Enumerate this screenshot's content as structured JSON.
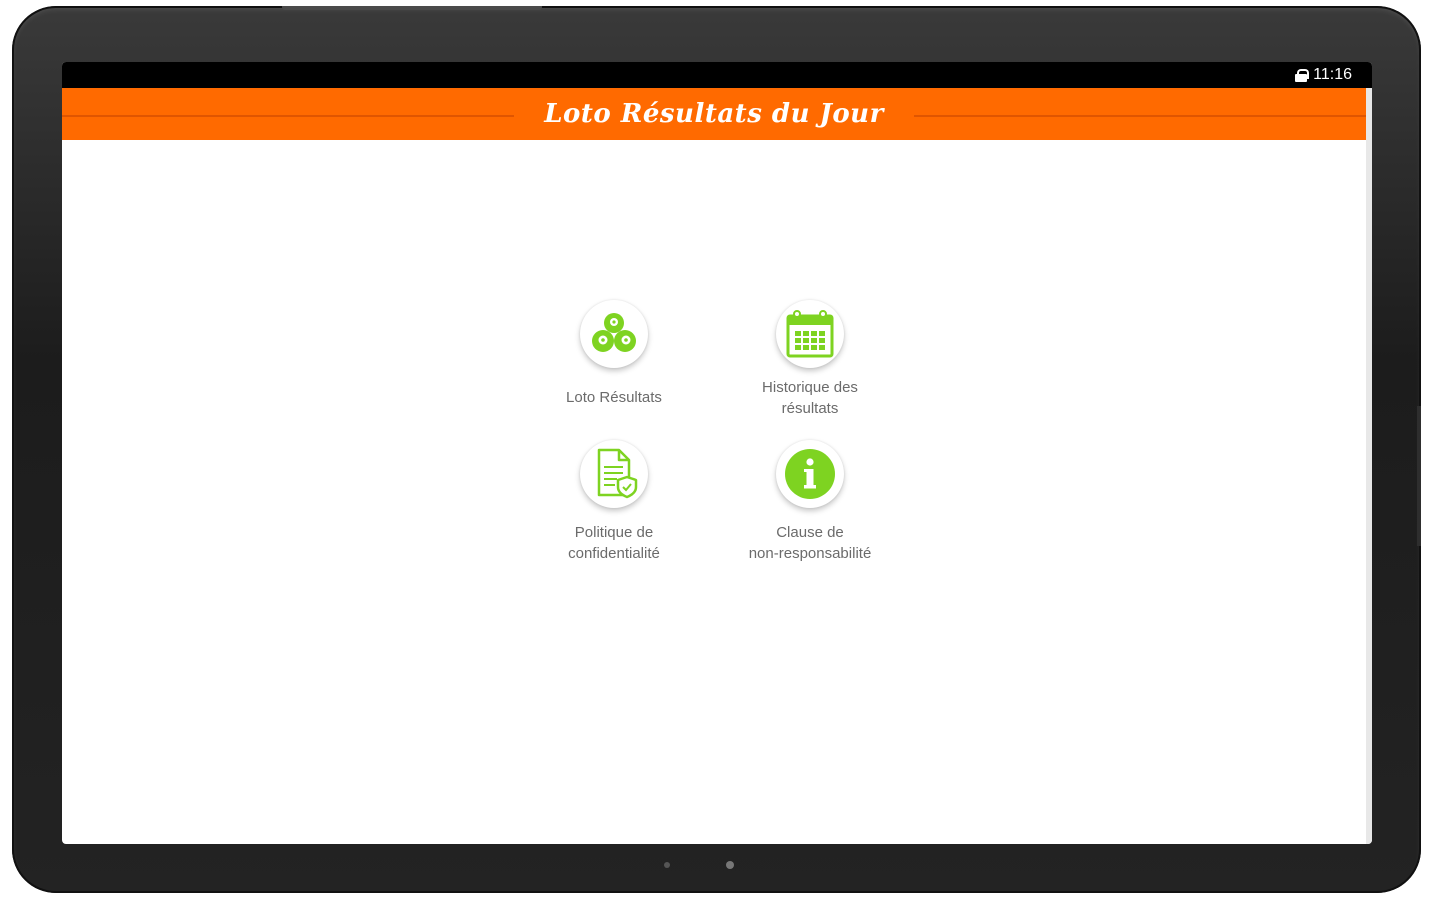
{
  "status_bar": {
    "time": "11:16"
  },
  "app_bar": {
    "title": "Loto Résultats du Jour"
  },
  "menu": {
    "items": [
      {
        "label": "Loto Résultats",
        "icon": "lottery-balls-icon"
      },
      {
        "label": "Historique des\nrésultats",
        "icon": "calendar-icon"
      },
      {
        "label": "Politique de\nconfidentialité",
        "icon": "document-shield-icon"
      },
      {
        "label": "Clause de\nnon-responsabilité",
        "icon": "info-icon"
      }
    ]
  },
  "colors": {
    "app_bar": "#ff6a00",
    "icon_green": "#7ed321",
    "label_gray": "#6b6b6b"
  }
}
